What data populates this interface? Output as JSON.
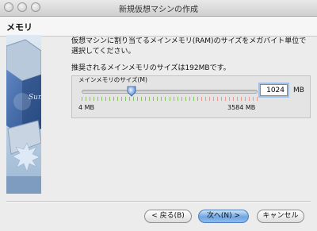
{
  "window": {
    "title": "新規仮想マシンの作成"
  },
  "page": {
    "heading": "メモリ",
    "description": "仮想マシンに割り当てるメインメモリ(RAM)のサイズをメガバイト単位で選択してください。",
    "recommended": "推奨されるメインメモリのサイズは192MBです。"
  },
  "memory": {
    "group_label": "メインメモリのサイズ(M)",
    "min_label": "4 MB",
    "max_label": "3584 MB",
    "min_mb": 4,
    "max_mb": 3584,
    "value": "1024",
    "value_mb": 1024,
    "unit": "MB"
  },
  "buttons": {
    "back": "< 戻る(B)",
    "next": "次へ(N) >",
    "cancel": "キャンセル"
  },
  "art": {
    "brand": "Sun"
  },
  "colors": {
    "accent": "#6fa6e2",
    "tick_green": "#88c060",
    "tick_red": "#e69a8c"
  }
}
